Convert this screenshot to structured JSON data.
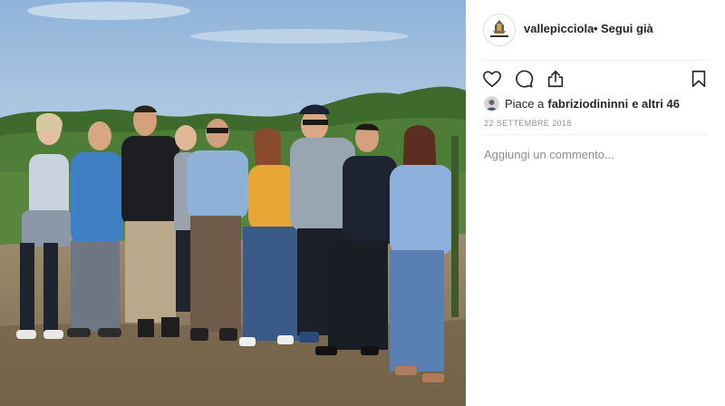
{
  "post": {
    "username": "vallepicciola",
    "separator": "•",
    "follow_label": "Segui già",
    "avatar_icon": "winery-logo-icon",
    "avatar_text": "VALLEPICCIOLA"
  },
  "actions": {
    "like_icon": "heart-icon",
    "comment_icon": "comment-bubble-icon",
    "share_icon": "share-icon",
    "save_icon": "bookmark-icon"
  },
  "likes": {
    "label": "Piace a",
    "user": "fabriziodininni",
    "others": "e altri 46"
  },
  "date": "22 SETTEMBRE 2018",
  "comment": {
    "placeholder": "Aggiungi un commento..."
  },
  "colors": {
    "text": "#262626",
    "muted": "#8e8e8e",
    "divider": "#efefef"
  }
}
